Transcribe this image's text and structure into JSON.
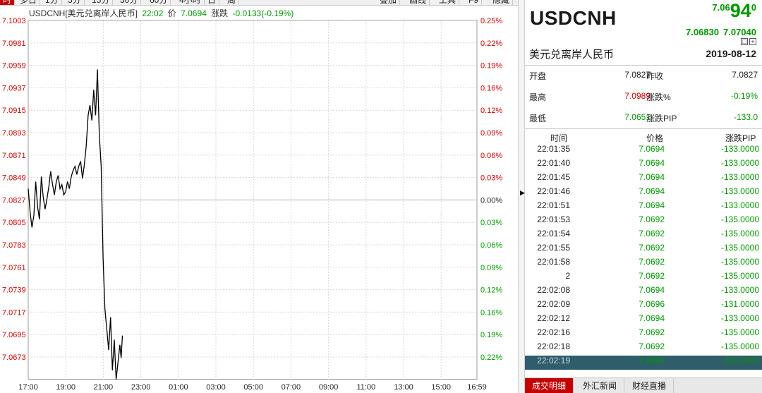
{
  "toolbar": {
    "left_tabs": [
      "时",
      "多日",
      "1分",
      "5分",
      "15分",
      "30分",
      "60分",
      "4小时",
      "日",
      "周"
    ],
    "right_tabs": [
      "叠加",
      "画线",
      "工具",
      "F9",
      "隐藏"
    ]
  },
  "header": {
    "symbol_full": "USDCNH[美元兑离岸人民币]",
    "time": "22:02",
    "price_label": "价",
    "price": "7.0694",
    "change_label": "涨跌",
    "change": "-0.0133(-0.19%)"
  },
  "quote": {
    "symbol": "USDCNH",
    "price_prefix": "7.06",
    "price_big": "94",
    "price_sup": "0",
    "bid": "7.06830",
    "ask": "7.07040",
    "name": "美元兑离岸人民币",
    "date": "2019-08-12",
    "icons": [
      "calendar-icon",
      "plus-icon"
    ]
  },
  "stats": {
    "open_label": "开盘",
    "open": "7.0827",
    "prev_close_label": "昨收",
    "prev_close": "7.0827",
    "high_label": "最高",
    "high": "7.0989",
    "change_pct_label": "涨跌%",
    "change_pct": "-0.19%",
    "low_label": "最低",
    "low": "7.0651",
    "change_pip_label": "涨跌PIP",
    "change_pip": "-133.0"
  },
  "ticks": {
    "columns": [
      "时间",
      "价格",
      "涨跌PIP"
    ],
    "rows": [
      {
        "time": "22:01:35",
        "price": "7.0694",
        "change": "-133.0000"
      },
      {
        "time": "22:01:40",
        "price": "7.0694",
        "change": "-133.0000"
      },
      {
        "time": "22:01:45",
        "price": "7.0694",
        "change": "-133.0000"
      },
      {
        "time": "22:01:46",
        "price": "7.0694",
        "change": "-133.0000"
      },
      {
        "time": "22:01:51",
        "price": "7.0694",
        "change": "-133.0000"
      },
      {
        "time": "22:01:53",
        "price": "7.0692",
        "change": "-135.0000"
      },
      {
        "time": "22:01:54",
        "price": "7.0692",
        "change": "-135.0000"
      },
      {
        "time": "22:01:55",
        "price": "7.0692",
        "change": "-135.0000"
      },
      {
        "time": "22:01:58",
        "price": "7.0692",
        "change": "-135.0000"
      },
      {
        "time": "2",
        "price": "7.0692",
        "change": "-135.0000"
      },
      {
        "time": "22:02:08",
        "price": "7.0694",
        "change": "-133.0000"
      },
      {
        "time": "22:02:09",
        "price": "7.0696",
        "change": "-131.0000"
      },
      {
        "time": "22:02:12",
        "price": "7.0694",
        "change": "-133.0000"
      },
      {
        "time": "22:02:16",
        "price": "7.0692",
        "change": "-135.0000"
      },
      {
        "time": "22:02:18",
        "price": "7.0692",
        "change": "-135.0000"
      },
      {
        "time": "22:02:19",
        "price": "7.0694",
        "change": "-133.0000"
      }
    ]
  },
  "bottom_tabs": [
    "成交明细",
    "外汇新闻",
    "财经直播"
  ],
  "colors": {
    "up": "#d00000",
    "down": "#009900",
    "accent": "#c40000",
    "selected_row": "#2f5d6b"
  },
  "chart_data": {
    "type": "line",
    "title": "",
    "ylim": [
      7.0651,
      7.1003
    ],
    "y_ticks_left": [
      "7.1003",
      "7.0981",
      "7.0959",
      "7.0937",
      "7.0915",
      "7.0893",
      "7.0871",
      "7.0849",
      "7.0827",
      "7.0805",
      "7.0783",
      "7.0761",
      "7.0739",
      "7.0717",
      "7.0695",
      "7.0673"
    ],
    "y_ticks_right": [
      "0.25%",
      "0.22%",
      "0.19%",
      "0.16%",
      "0.12%",
      "0.09%",
      "0.06%",
      "0.03%",
      "0.00%",
      "0.03%",
      "0.06%",
      "0.09%",
      "0.12%",
      "0.16%",
      "0.19%",
      "0.22%"
    ],
    "right_tick_colors": [
      "up",
      "up",
      "up",
      "up",
      "up",
      "up",
      "up",
      "up",
      "neutral",
      "down",
      "down",
      "down",
      "down",
      "down",
      "down",
      "down"
    ],
    "x_ticks": [
      "17:00",
      "19:00",
      "21:00",
      "23:00",
      "01:00",
      "03:00",
      "05:00",
      "07:00",
      "09:00",
      "11:00",
      "13:00",
      "15:00",
      "16:59"
    ],
    "reference": 7.0827,
    "grid": true,
    "series": [
      {
        "x": [
          "17:00",
          "17:06",
          "17:12",
          "17:18",
          "17:24",
          "17:30",
          "17:36",
          "17:42",
          "17:48",
          "17:54",
          "18:00",
          "18:06",
          "18:12",
          "18:18",
          "18:24",
          "18:30",
          "18:36",
          "18:42",
          "18:48",
          "18:54",
          "19:00",
          "19:06",
          "19:12",
          "19:18",
          "19:24",
          "19:30",
          "19:36",
          "19:42",
          "19:48",
          "19:54",
          "20:00",
          "20:06",
          "20:12",
          "20:18",
          "20:24",
          "20:30",
          "20:36",
          "20:42",
          "20:48",
          "20:54",
          "21:00",
          "21:06",
          "21:12",
          "21:18",
          "21:24",
          "21:30",
          "21:36",
          "21:42",
          "21:48",
          "21:54",
          "21:58",
          "22:02"
        ],
        "values": [
          7.0838,
          7.0815,
          7.08,
          7.0812,
          7.0845,
          7.082,
          7.0808,
          7.085,
          7.083,
          7.0818,
          7.0828,
          7.084,
          7.0855,
          7.0842,
          7.0832,
          7.0845,
          7.0851,
          7.0838,
          7.0842,
          7.0832,
          7.0835,
          7.0845,
          7.0838,
          7.085,
          7.0856,
          7.086,
          7.0852,
          7.086,
          7.0865,
          7.0848,
          7.0862,
          7.088,
          7.091,
          7.092,
          7.0905,
          7.0935,
          7.091,
          7.0955,
          7.089,
          7.086,
          7.077,
          7.072,
          7.07,
          7.068,
          7.0712,
          7.066,
          7.069,
          7.0651,
          7.0668,
          7.0685,
          7.0672,
          7.0694
        ]
      }
    ]
  }
}
